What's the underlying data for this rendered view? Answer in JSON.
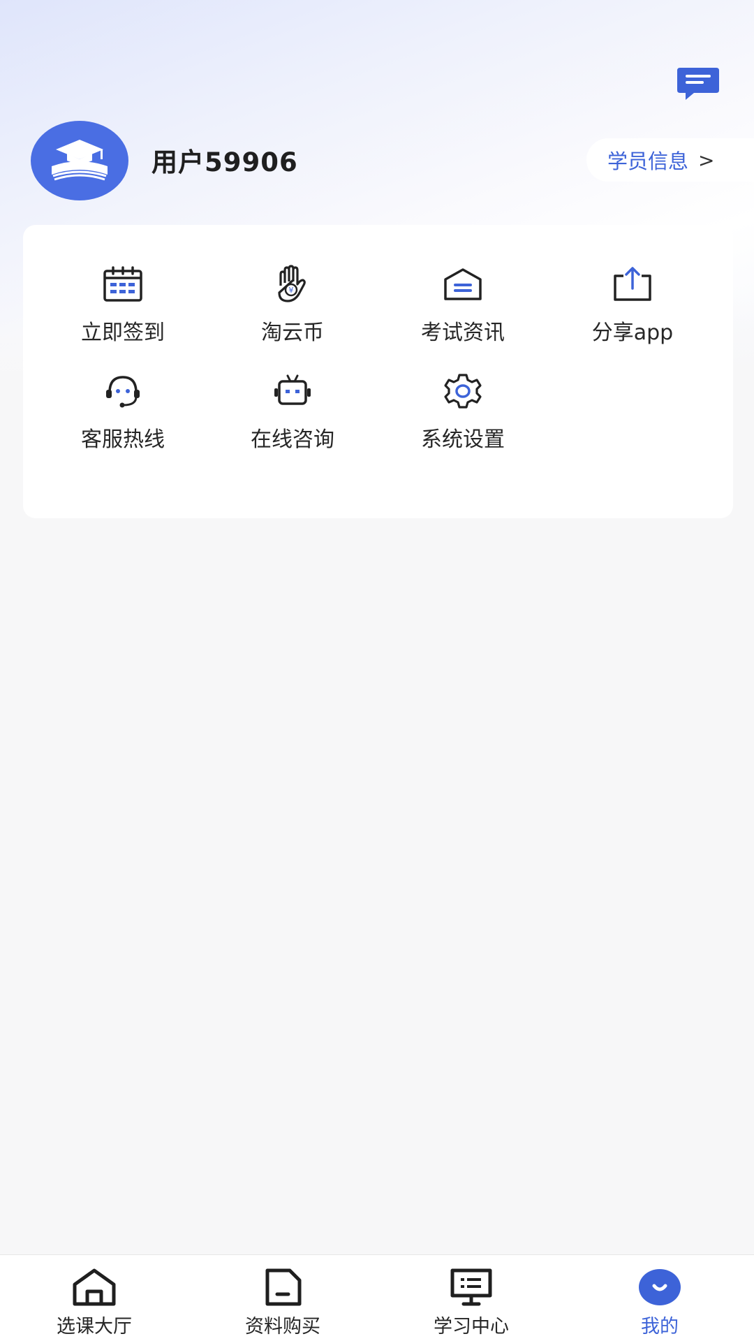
{
  "header": {
    "username": "用户59906",
    "student_info_label": "学员信息",
    "chevron": ">"
  },
  "menu": {
    "items": [
      {
        "label": "立即签到",
        "icon": "calendar-icon"
      },
      {
        "label": "淘云币",
        "icon": "coin-hand-icon"
      },
      {
        "label": "考试资讯",
        "icon": "news-icon"
      },
      {
        "label": "分享app",
        "icon": "share-icon"
      },
      {
        "label": "客服热线",
        "icon": "headset-icon"
      },
      {
        "label": "在线咨询",
        "icon": "robot-icon"
      },
      {
        "label": "系统设置",
        "icon": "gear-icon"
      }
    ]
  },
  "tabbar": {
    "tabs": [
      {
        "label": "选课大厅",
        "icon": "home-icon",
        "active": false
      },
      {
        "label": "资料购买",
        "icon": "document-icon",
        "active": false
      },
      {
        "label": "学习中心",
        "icon": "presentation-icon",
        "active": false
      },
      {
        "label": "我的",
        "icon": "profile-smile-icon",
        "active": true
      }
    ]
  },
  "colors": {
    "accent": "#3d63d8",
    "avatar_bg": "#4a6ee3",
    "background": "#f7f7f8"
  }
}
